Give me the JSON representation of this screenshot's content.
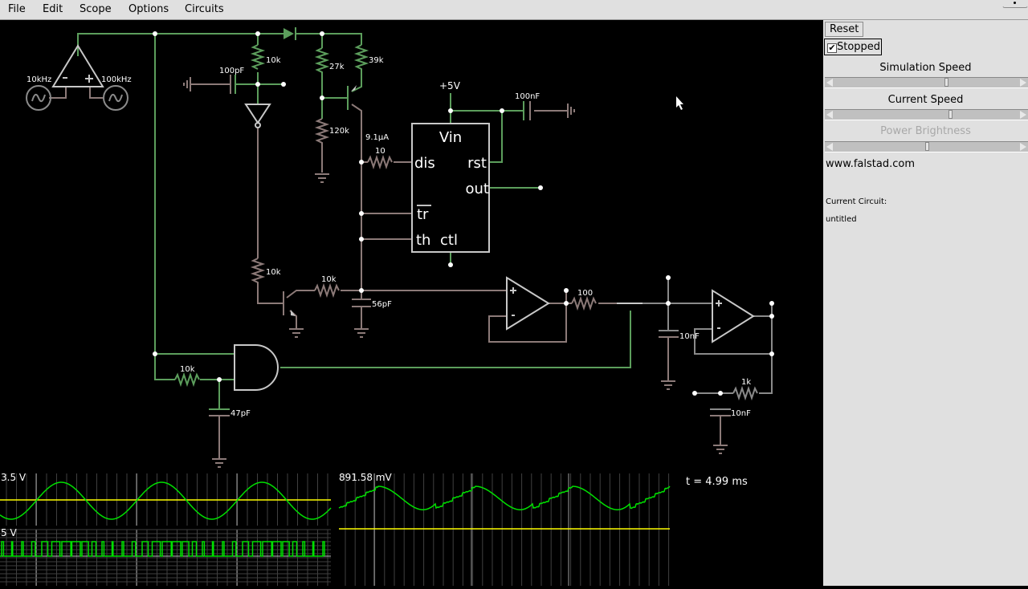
{
  "menu": [
    "File",
    "Edit",
    "Scope",
    "Options",
    "Circuits"
  ],
  "panel": {
    "reset_label": "Reset",
    "stopped_label": "Stopped",
    "stopped_checked": true,
    "sliders": [
      {
        "label": "Simulation Speed",
        "value": 0.61,
        "enabled": true
      },
      {
        "label": "Current Speed",
        "value": 0.63,
        "enabled": true
      },
      {
        "label": "Power Brightness",
        "value": 0.5,
        "enabled": false
      }
    ],
    "website": "www.falstad.com",
    "current_circuit_label": "Current Circuit:",
    "current_circuit_name": "untitled"
  },
  "colors": {
    "wire_high": "#5c9e5c",
    "wire_low": "#8c7a78",
    "element": "#c8c8c8",
    "node": "#ffffff",
    "scope_trace": "#00e000",
    "scope_zero": "#ffff00",
    "scope_grid": "#404040",
    "scope_grid_major": "#a0a0a0"
  },
  "circuit": {
    "labels": {
      "src1_freq": "10kHz",
      "src2_freq": "100kHz",
      "r_10k_a": "10k",
      "c_100pF": "100pF",
      "r_27k": "27k",
      "r_39k": "39k",
      "r_120k": "120k",
      "supply": "+5V",
      "c_100nF": "100nF",
      "current": "9.1µA",
      "r_10": "10",
      "r_10k_b": "10k",
      "r_10k_c": "10k",
      "c_56pF": "56pF",
      "r_10k_d": "10k",
      "c_47pF": "47pF",
      "r_100": "100",
      "c_10nF_a": "10nF",
      "r_1k": "1k",
      "c_10nF_b": "10nF"
    },
    "timer555": {
      "vin": "Vin",
      "dis": "dis",
      "rst": "rst",
      "out": "out",
      "tr": "tr",
      "th": "th",
      "ctl": "ctl"
    }
  },
  "scopes": [
    {
      "label": "3.5 V",
      "type": "sine"
    },
    {
      "label": "5 V",
      "type": "pwm"
    },
    {
      "label": "891.58 mV",
      "type": "filtered"
    }
  ],
  "time": "t = 4.99 ms"
}
